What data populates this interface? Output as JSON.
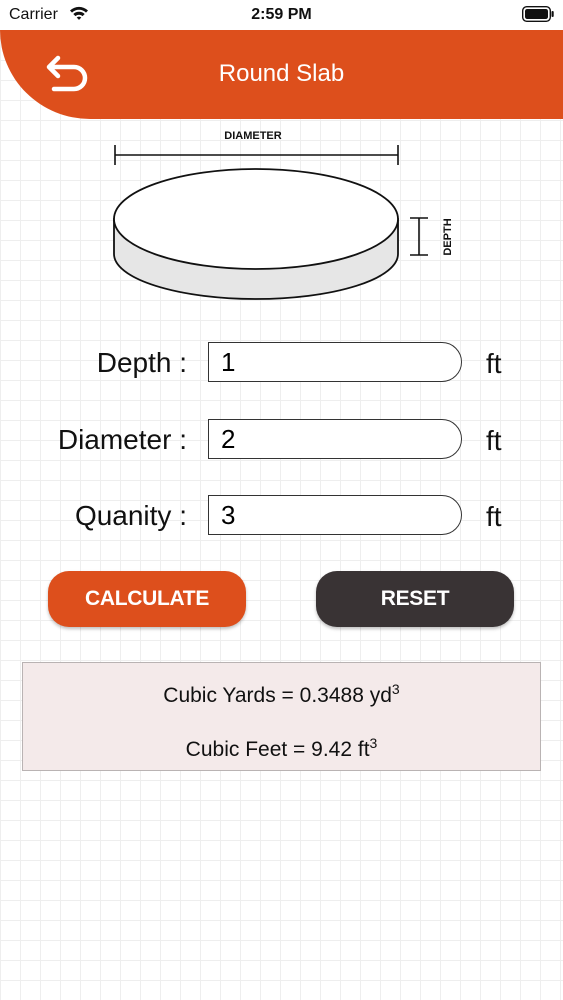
{
  "status_bar": {
    "carrier": "Carrier",
    "time": "2:59 PM",
    "icons": [
      "wifi-icon",
      "battery-icon"
    ]
  },
  "header": {
    "title": "Round Slab",
    "back_icon": "back-arrow-icon",
    "color": "#dd4f1c"
  },
  "diagram": {
    "diameter_label": "DIAMETER",
    "depth_label": "DEPTH"
  },
  "form": {
    "rows": [
      {
        "label": "Depth :",
        "value": "1",
        "unit": "ft"
      },
      {
        "label": "Diameter :",
        "value": "2",
        "unit": "ft"
      },
      {
        "label": "Quanity :",
        "value": "3",
        "unit": "ft"
      }
    ]
  },
  "buttons": {
    "calculate": "CALCULATE",
    "reset": "RESET",
    "calculate_color": "#dd4f1c",
    "reset_color": "#393334"
  },
  "results": {
    "cubic_yards_text": "Cubic Yards = 0.3488 yd",
    "cubic_yards_exp": "3",
    "cubic_feet_text": "Cubic Feet = 9.42 ft",
    "cubic_feet_exp": "3"
  }
}
